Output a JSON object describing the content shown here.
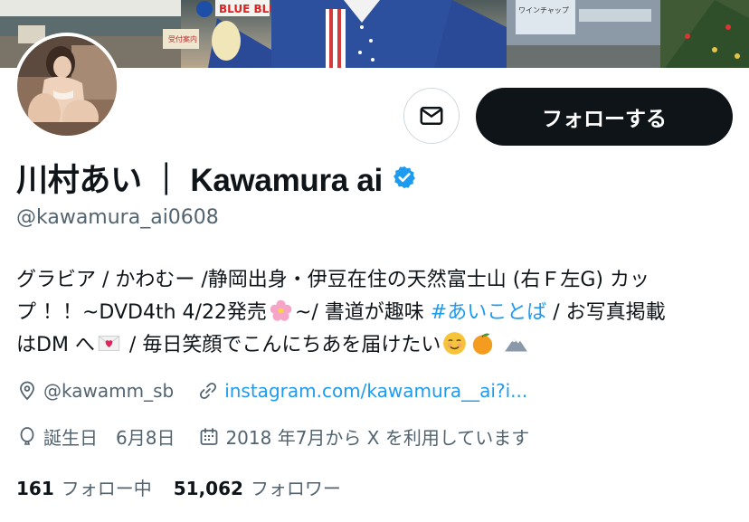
{
  "banner": {
    "sign_text": "BLUE BLU",
    "store_sign_text": "ワインチャップ",
    "poster_text": "受付案内"
  },
  "actions": {
    "message_icon": "envelope-icon",
    "follow_label": "フォローする"
  },
  "profile": {
    "display_name": "川村あい ｜ Kawamura ai",
    "verified_icon": "verified-badge-icon",
    "handle": "@kawamura_ai0608",
    "bio": {
      "line1": "グラビア / かわむー /静岡出身・伊豆在住の天然富士山 (右Ｆ左G) カッ",
      "line2_text": "プ ！！~DVD4th 4/22発売",
      "line2_after_emoji": "~/ 書道が趣味 ",
      "hashtag": "#あいことば",
      "line2_tail": " / お写真掲載",
      "line3_text": "はDM へ",
      "line3_mid": " / 毎日笑顔でこんにちあを届けたい",
      "emojis": [
        "cherry-blossom",
        "love-letter",
        "smiling-face",
        "tangerine",
        "mountain"
      ]
    },
    "location": "@kawamm_sb",
    "website": "instagram.com/kawamura__ai?i...",
    "birthday": "誕生日　6月8日",
    "joined": "2018 年7月から X を利用しています",
    "following_count": "161",
    "following_label": "フォロー中",
    "followers_count": "51,062",
    "followers_label": "フォロワー"
  },
  "colors": {
    "accent": "#1d9bf0",
    "text": "#0f1419",
    "secondary": "#536471",
    "button_dark": "#0f1419"
  }
}
